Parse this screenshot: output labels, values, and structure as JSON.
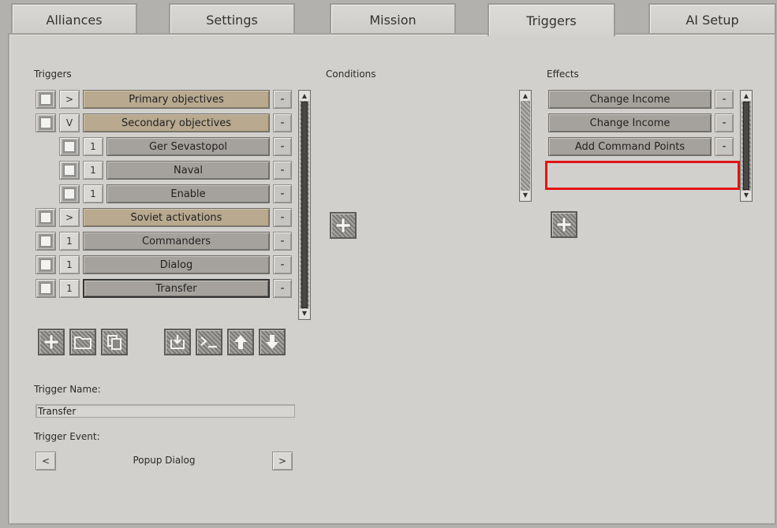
{
  "tabs": [
    {
      "label": "Alliances",
      "active": false
    },
    {
      "label": "Settings",
      "active": false
    },
    {
      "label": "Mission",
      "active": false
    },
    {
      "label": "Triggers",
      "active": true
    },
    {
      "label": "AI Setup",
      "active": false
    }
  ],
  "sections": {
    "triggers": "Triggers",
    "conditions": "Conditions",
    "effects": "Effects"
  },
  "triggers": [
    {
      "expander": ">",
      "label": "Primary objectives",
      "style": "tan",
      "indent": false
    },
    {
      "expander": "V",
      "label": "Secondary objectives",
      "style": "tan",
      "indent": false
    },
    {
      "expander": "1",
      "label": "Ger Sevastopol",
      "style": "grey",
      "indent": true
    },
    {
      "expander": "1",
      "label": "Naval",
      "style": "grey",
      "indent": true
    },
    {
      "expander": "1",
      "label": "Enable",
      "style": "grey",
      "indent": true
    },
    {
      "expander": ">",
      "label": "Soviet activations",
      "style": "tan",
      "indent": false
    },
    {
      "expander": "1",
      "label": "Commanders",
      "style": "grey",
      "indent": false
    },
    {
      "expander": "1",
      "label": "Dialog",
      "style": "grey",
      "indent": false
    },
    {
      "expander": "1",
      "label": "Transfer",
      "style": "grey",
      "indent": false,
      "selected": true
    }
  ],
  "effects": [
    {
      "label": "Change Income"
    },
    {
      "label": "Change Income"
    },
    {
      "label": "Add Command Points"
    }
  ],
  "remove_symbol": "-",
  "scroll_up": "▲",
  "scroll_down": "▼",
  "trigger_name": {
    "label": "Trigger Name:",
    "value": "Transfer"
  },
  "trigger_event": {
    "label": "Trigger Event:",
    "prev": "<",
    "value": "Popup Dialog",
    "next": ">"
  },
  "toolbar_icons": [
    "plus-icon",
    "folder-icon",
    "copy-icon",
    "import-icon",
    "script-icon",
    "arrow-up-icon",
    "arrow-down-icon"
  ],
  "colors": {
    "highlight": "#e21414",
    "tan_bar": "#b8a98f",
    "grey_bar": "#a5a29d"
  }
}
